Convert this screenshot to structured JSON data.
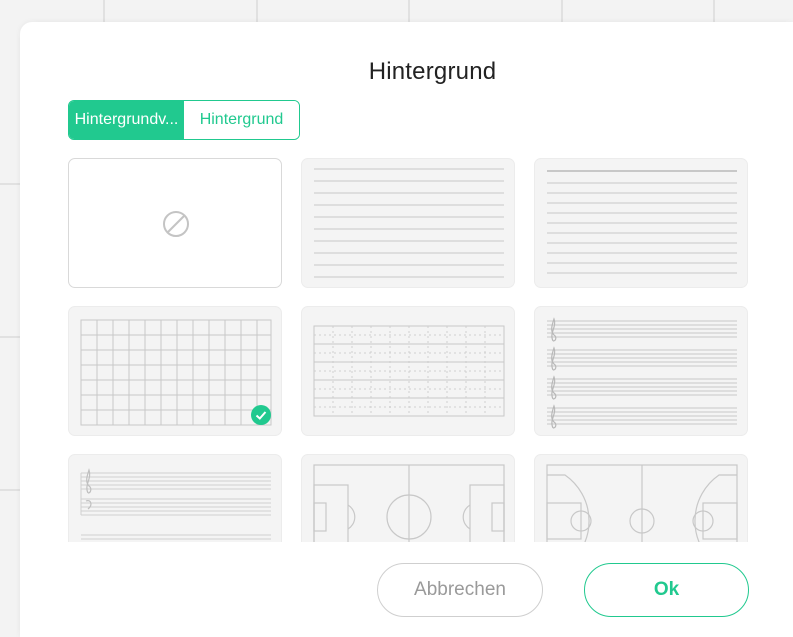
{
  "dialog": {
    "title": "Hintergrund",
    "tabs": [
      {
        "label": "Hintergrundv...",
        "active": true
      },
      {
        "label": "Hintergrund",
        "active": false
      }
    ],
    "backgrounds": [
      {
        "name": "none",
        "icon": "no-background-icon",
        "selected": false
      },
      {
        "name": "lined",
        "selected": false
      },
      {
        "name": "lined-tight",
        "selected": false
      },
      {
        "name": "grid",
        "selected": true,
        "icon": "checkmark-icon"
      },
      {
        "name": "dot-grid",
        "selected": false
      },
      {
        "name": "music-staff",
        "selected": false
      },
      {
        "name": "music-staff-double",
        "selected": false
      },
      {
        "name": "soccer-field",
        "selected": false
      },
      {
        "name": "basketball-court",
        "selected": false
      }
    ],
    "cancel_label": "Abbrechen",
    "ok_label": "Ok"
  },
  "colors": {
    "accent": "#21c98f",
    "card_bg": "#f4f4f4",
    "line": "#c8c8c8"
  }
}
